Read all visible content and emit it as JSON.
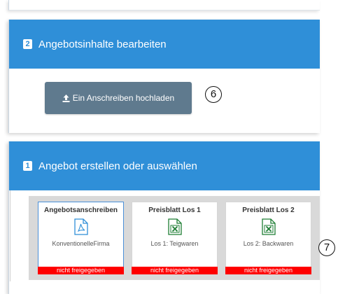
{
  "panel_upload": {
    "step": "2",
    "title": "Angebotsinhalte bearbeiten",
    "button_label": "Ein Anschreiben hochladen"
  },
  "panel_offers": {
    "step": "1",
    "title": "Angebot erstellen oder auswählen",
    "tiles": [
      {
        "title": "Angebotsanschreiben",
        "icon": "pdf-icon",
        "subtitle": "KonventionelleFirma",
        "status": "nicht freigegeben"
      },
      {
        "title": "Preisblatt Los 1",
        "icon": "excel-icon",
        "subtitle": "Los 1: Teigwaren",
        "status": "nicht freigegeben"
      },
      {
        "title": "Preisblatt Los 2",
        "icon": "excel-icon",
        "subtitle": "Los 2: Backwaren",
        "status": "nicht freigegeben"
      }
    ]
  },
  "annotations": {
    "upload": "6",
    "tiles": "7"
  },
  "colors": {
    "header": "#2f8fd8",
    "button": "#5f7a8e",
    "status": "#ff0000",
    "excel": "#1e7e34",
    "pdf": "#2f8fd8"
  }
}
